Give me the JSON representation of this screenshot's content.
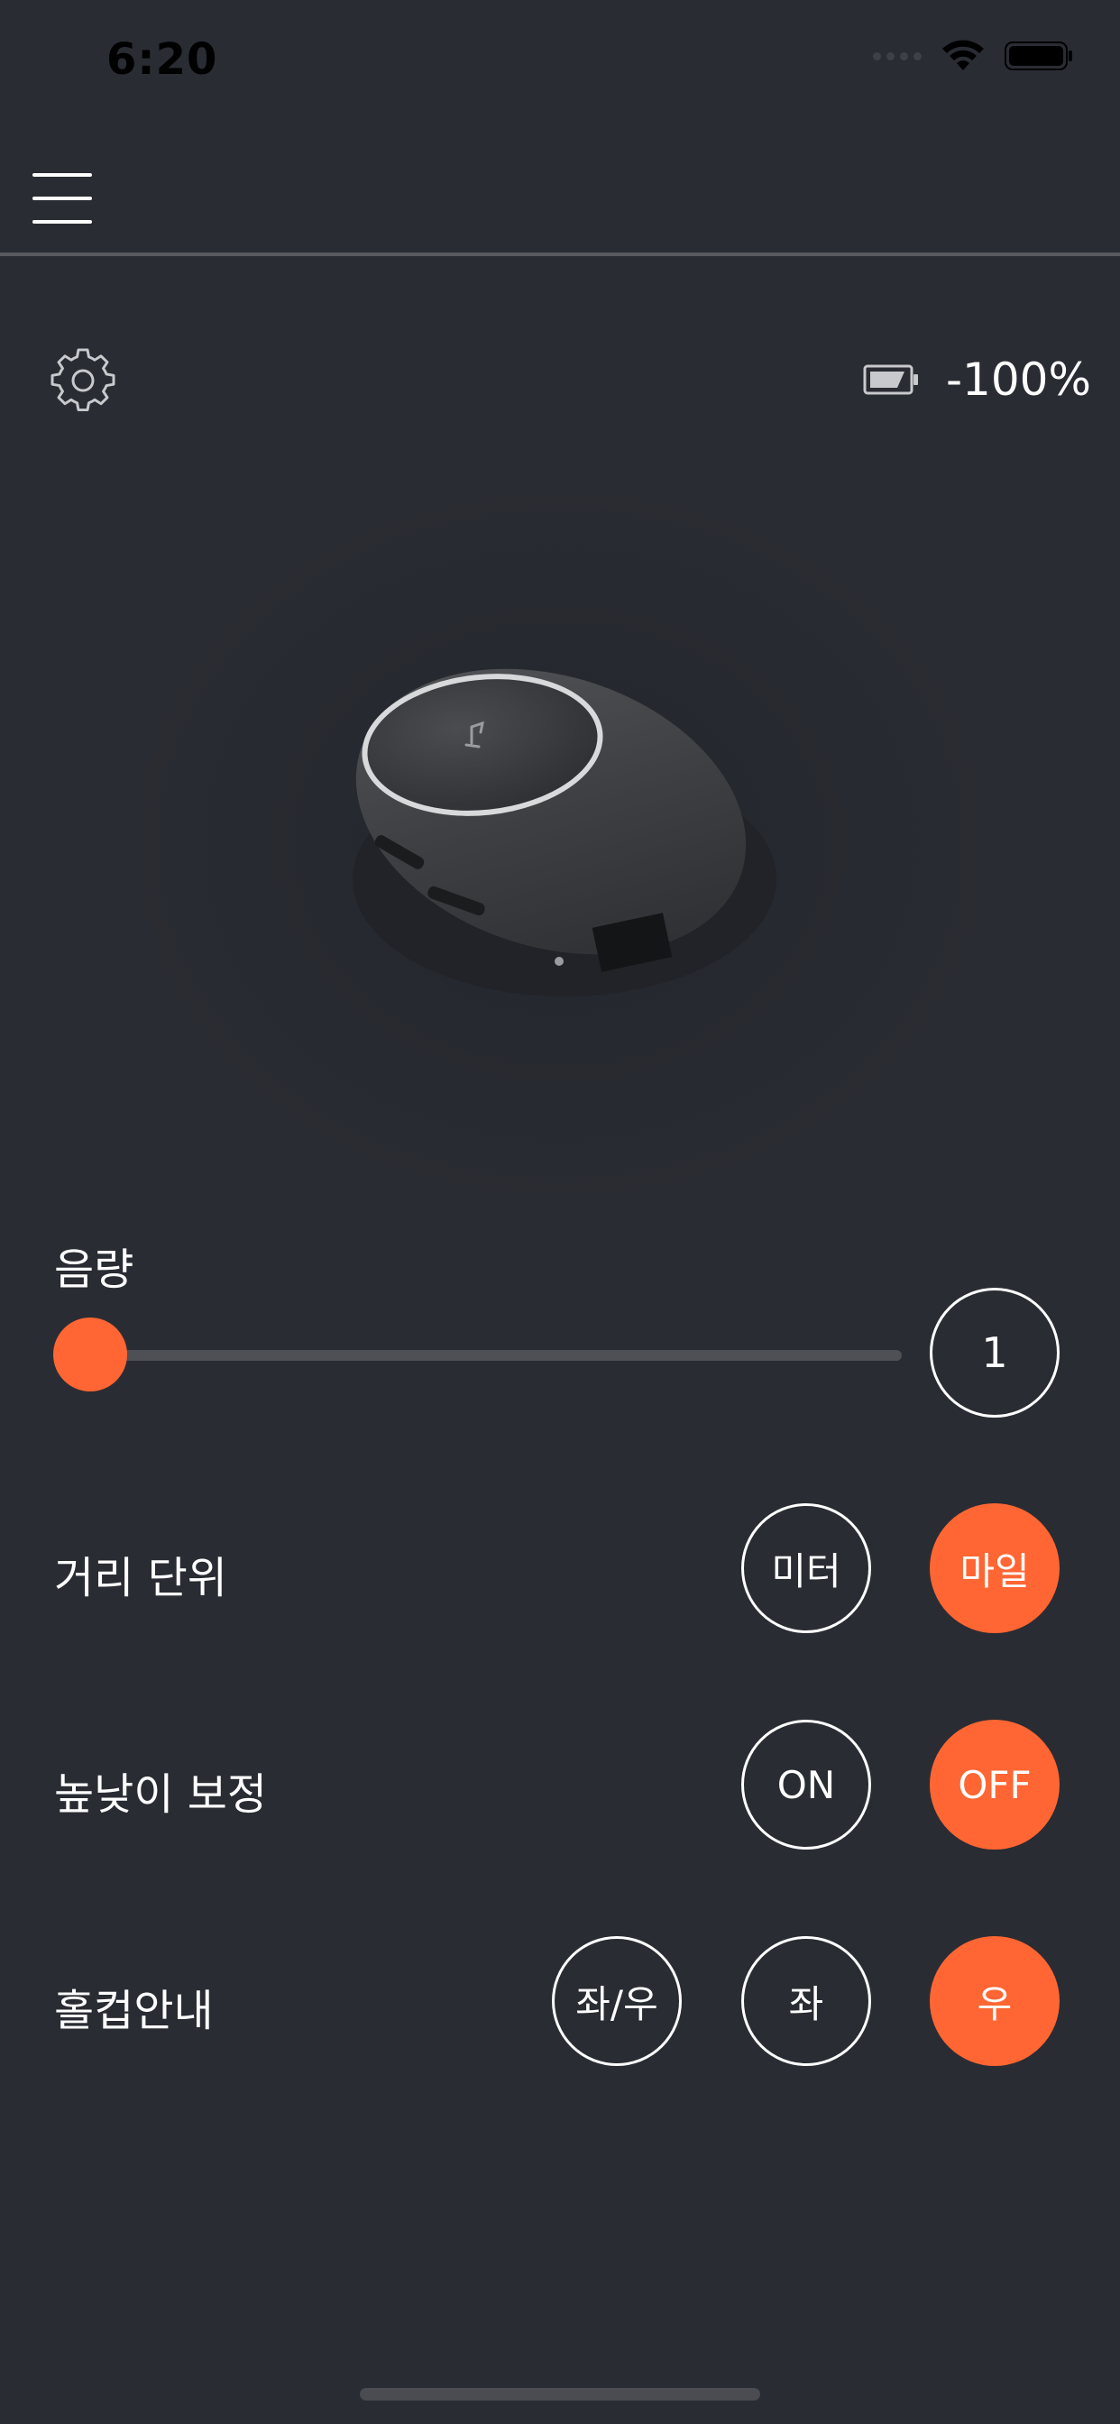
{
  "status_bar": {
    "time": "6:20"
  },
  "header": {
    "menu_icon": "hamburger-menu-icon"
  },
  "top_row": {
    "settings_icon": "gear-icon",
    "battery_icon": "battery-icon",
    "battery_text": "-100%"
  },
  "device": {
    "image": "device-product-image"
  },
  "volume": {
    "label": "음량",
    "value": "1",
    "level": 0
  },
  "distance_unit": {
    "label": "거리 단위",
    "options": [
      "미터",
      "마일"
    ],
    "selected": "마일"
  },
  "elevation": {
    "label": "높낮이 보정",
    "options": [
      "ON",
      "OFF"
    ],
    "selected": "OFF"
  },
  "hole_cup": {
    "label": "홀컵안내",
    "options": [
      "좌/우",
      "좌",
      "우"
    ],
    "selected": "우"
  },
  "colors": {
    "background": "#2a2c33",
    "accent": "#ff6633",
    "track": "#4e5056"
  }
}
